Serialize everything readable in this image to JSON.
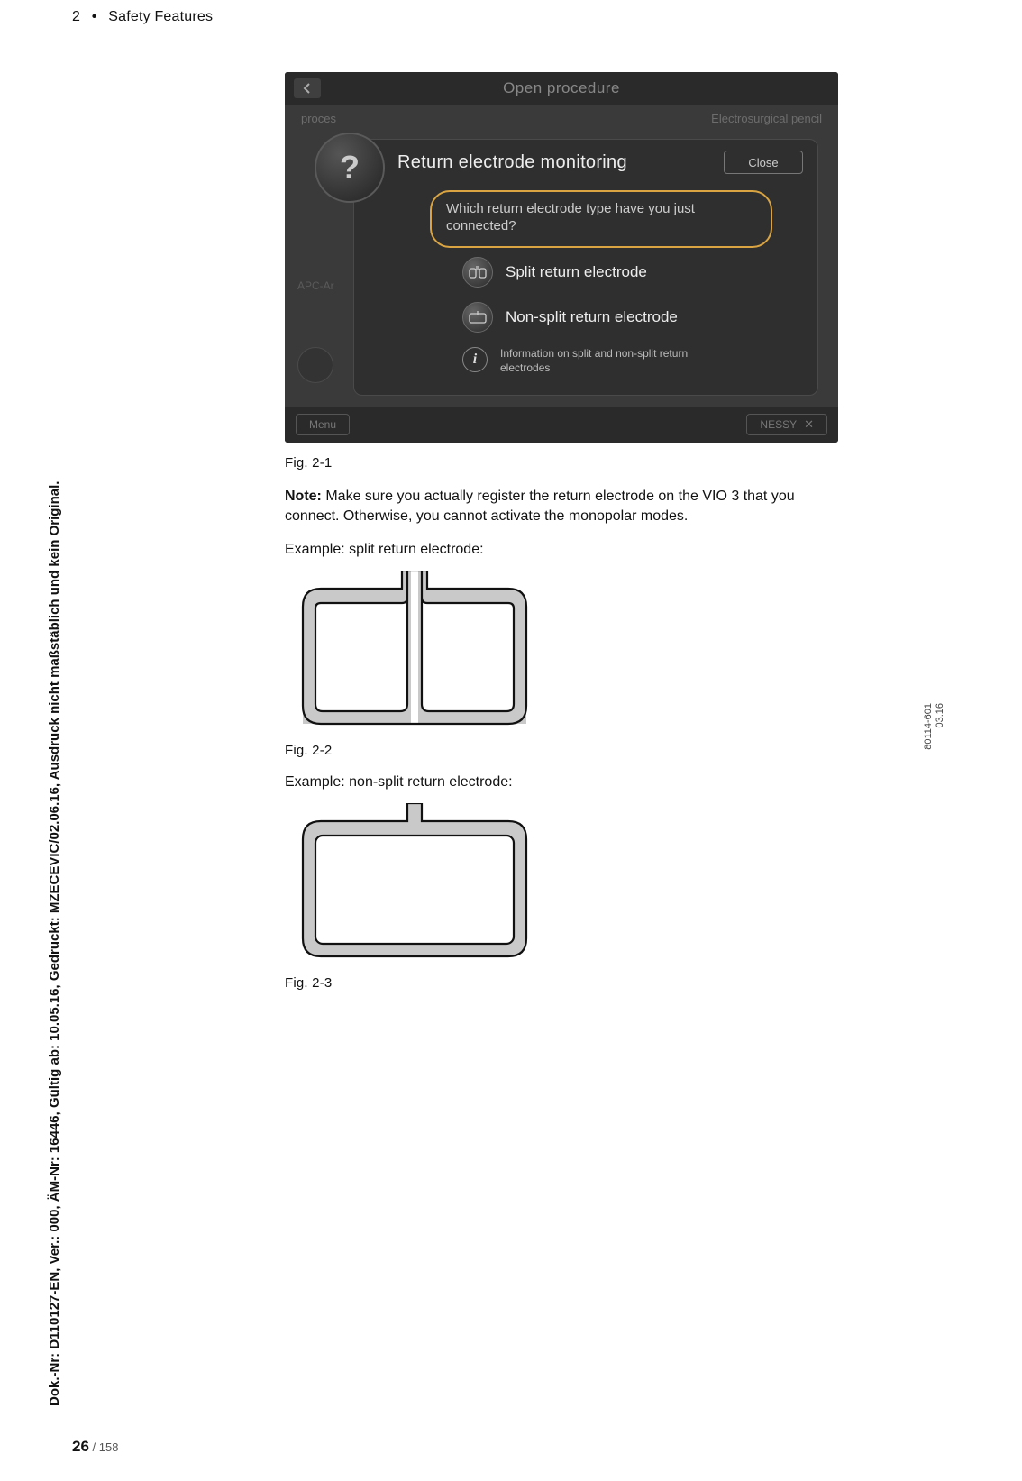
{
  "header": {
    "chapter_num": "2",
    "chapter_sep": "•",
    "chapter_title": "Safety Features"
  },
  "sideText": "Dok.-Nr: D110127-EN, Ver.: 000, ÄM-Nr: 16446, Gültig ab: 10.05.16, Gedruckt: MZECEVIC/02.06.16, Ausdruck nicht maßstäblich und kein Original.",
  "screenshot": {
    "topTitle": "Open procedure",
    "row1_left": "proces",
    "row1_right": "Electrosurgical pencil",
    "modalTitle": "Return electrode monitoring",
    "closeLabel": "Close",
    "question": "Which return electrode type have you just connected?",
    "opt1": "Split return electrode",
    "opt2": "Non-split return electrode",
    "infoText": "Information on split and non-split return electrodes",
    "sideLabel": "APC-Ar",
    "menuLabel": "Menu",
    "nessyLabel": "NESSY"
  },
  "fig1": "Fig. 2-1",
  "noteBold": "Note:",
  "noteText": " Make sure you actually register the return electrode on the VIO 3 that you connect. Otherwise, you cannot activate the monopolar modes.",
  "example1": "Example: split return electrode:",
  "fig2": "Fig. 2-2",
  "example2": "Example: non-split return electrode:",
  "fig3": "Fig. 2-3",
  "rightCode1": "80114-601",
  "rightCode2": "03.16",
  "footer": {
    "pageNum": "26",
    "sep": " / ",
    "total": "158"
  }
}
